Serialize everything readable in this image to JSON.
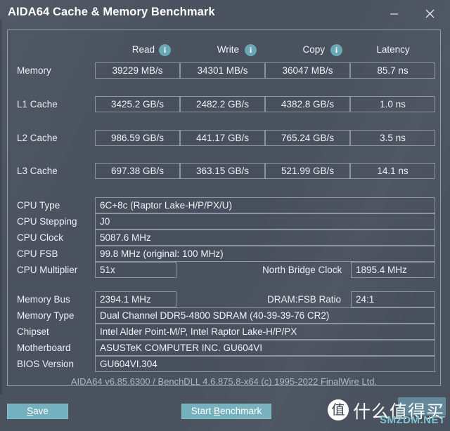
{
  "window": {
    "title": "AIDA64 Cache & Memory Benchmark",
    "minimize_label": "–",
    "close_label": "×"
  },
  "benchmark_table": {
    "columns": [
      "Read",
      "Write",
      "Copy",
      "Latency"
    ],
    "info_icon_label": "i",
    "rows": [
      {
        "label": "Memory",
        "read": "39229 MB/s",
        "write": "34301 MB/s",
        "copy": "36047 MB/s",
        "latency": "85.7 ns"
      },
      {
        "label": "L1 Cache",
        "read": "3425.2 GB/s",
        "write": "2482.2 GB/s",
        "copy": "4382.8 GB/s",
        "latency": "1.0 ns"
      },
      {
        "label": "L2 Cache",
        "read": "986.59 GB/s",
        "write": "441.17 GB/s",
        "copy": "765.24 GB/s",
        "latency": "3.5 ns"
      },
      {
        "label": "L3 Cache",
        "read": "697.38 GB/s",
        "write": "363.15 GB/s",
        "copy": "521.99 GB/s",
        "latency": "14.1 ns"
      }
    ]
  },
  "cpu_info": {
    "cpu_type_label": "CPU Type",
    "cpu_type_value": "6C+8c   (Raptor Lake-H/P/PX/U)",
    "cpu_stepping_label": "CPU Stepping",
    "cpu_stepping_value": "J0",
    "cpu_clock_label": "CPU Clock",
    "cpu_clock_value": "5087.6 MHz",
    "cpu_fsb_label": "CPU FSB",
    "cpu_fsb_value": "99.8 MHz  (original: 100 MHz)",
    "cpu_multiplier_label": "CPU Multiplier",
    "cpu_multiplier_value": "51x",
    "north_bridge_clock_label": "North Bridge Clock",
    "north_bridge_clock_value": "1895.4 MHz"
  },
  "memory_info": {
    "memory_bus_label": "Memory Bus",
    "memory_bus_value": "2394.1 MHz",
    "dram_fsb_ratio_label": "DRAM:FSB Ratio",
    "dram_fsb_ratio_value": "24:1",
    "memory_type_label": "Memory Type",
    "memory_type_value": "Dual Channel DDR5-4800 SDRAM  (40-39-39-76 CR2)",
    "chipset_label": "Chipset",
    "chipset_value": "Intel Alder Point-M/P, Intel Raptor Lake-H/P/PX",
    "motherboard_label": "Motherboard",
    "motherboard_value": "ASUSTeK COMPUTER INC. GU604VI",
    "bios_version_label": "BIOS Version",
    "bios_version_value": "GU604VI.304"
  },
  "footer": {
    "version_line": "AIDA64 v6.85.6300 / BenchDLL 4.6.875.8-x64  (c) 1995-2022 FinalWire Ltd."
  },
  "buttons": {
    "save": {
      "pre": "",
      "accel": "S",
      "post": "ave"
    },
    "start_benchmark": {
      "pre": "Start ",
      "accel": "B",
      "post": "enchmark"
    }
  },
  "watermark": {
    "mark": "值",
    "text": "什么值得买",
    "sub": "SMZDM.NET"
  },
  "colors": {
    "window_bg": "#4a5260",
    "accent_teal": "#74b0bd",
    "info_icon": "#6aa7b4",
    "border": "#8b94a2",
    "text": "#eceff3"
  }
}
